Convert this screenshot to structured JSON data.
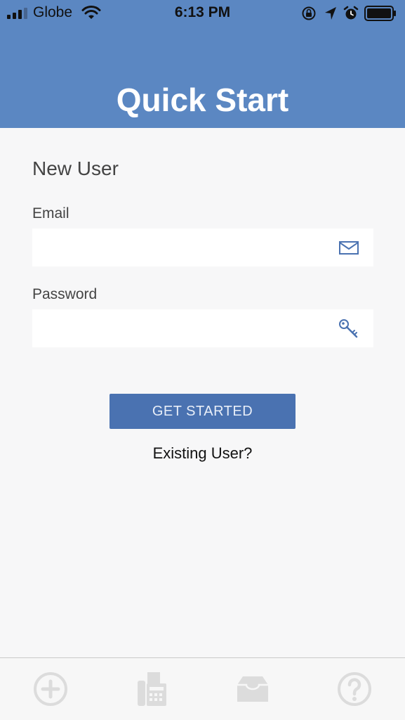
{
  "status_bar": {
    "carrier": "Globe",
    "time": "6:13 PM"
  },
  "header": {
    "title": "Quick Start"
  },
  "form": {
    "section_title": "New User",
    "email_label": "Email",
    "email_value": "",
    "password_label": "Password",
    "password_value": "",
    "submit_label": "GET STARTED",
    "existing_user_label": "Existing User?"
  },
  "tab_bar": {
    "tabs": [
      "add-icon",
      "fax-machine-icon",
      "inbox-icon",
      "help-icon"
    ]
  },
  "colors": {
    "header_bg": "#5b87c2",
    "button_bg": "#4a72b1",
    "page_bg": "#f7f7f8",
    "icon_blue": "#4a72b1",
    "tab_icon_gray": "#dcdcdc"
  }
}
